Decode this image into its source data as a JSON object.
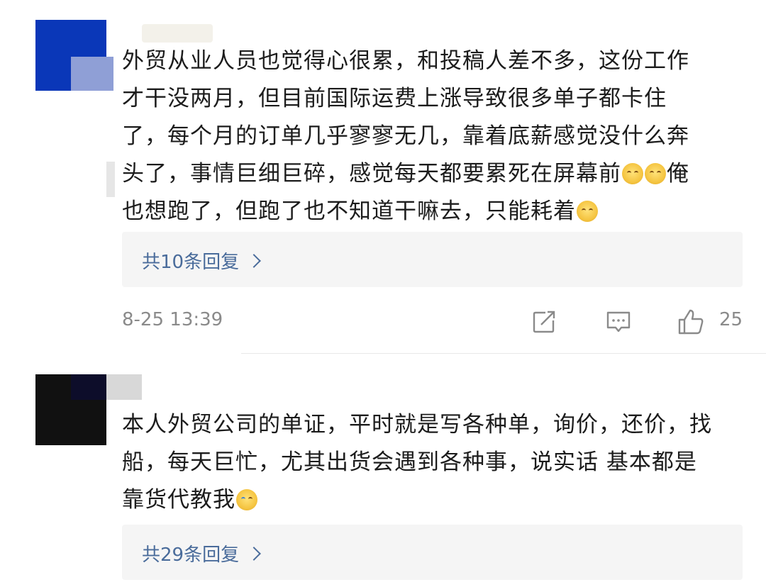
{
  "comments": [
    {
      "lines": [
        "外贸从业人员也觉得心很累，和投稿人差不多，这份工作",
        "才干没两月，但目前国际运费上涨导致很多单子都卡住",
        "了，每个月的订单几乎寥寥无几，靠着底薪感觉没什么奔",
        "头了，事情巨细巨碎，感觉每天都要累死在屏幕前",
        "也想跑了，但跑了也不知道干嘛去，只能耗着"
      ],
      "line4_after": "俺",
      "reply_label": "共10条回复",
      "time": "8-25 13:39",
      "like_count": "25"
    },
    {
      "lines": [
        "本人外贸公司的单证，平时就是写各种单，询价，还价，找",
        "船，每天巨忙，尤其出货会遇到各种事，说实话 基本都是",
        "靠货代教我"
      ],
      "reply_label": "共29条回复"
    }
  ],
  "icons": {
    "share": "share-icon",
    "comment": "comment-icon",
    "like": "thumbs-up-icon",
    "chevron": "chevron-right-icon"
  },
  "colors": {
    "link": "#4a6c9b",
    "meta": "#8a8a8a",
    "reply_bg": "#f5f5f5"
  }
}
